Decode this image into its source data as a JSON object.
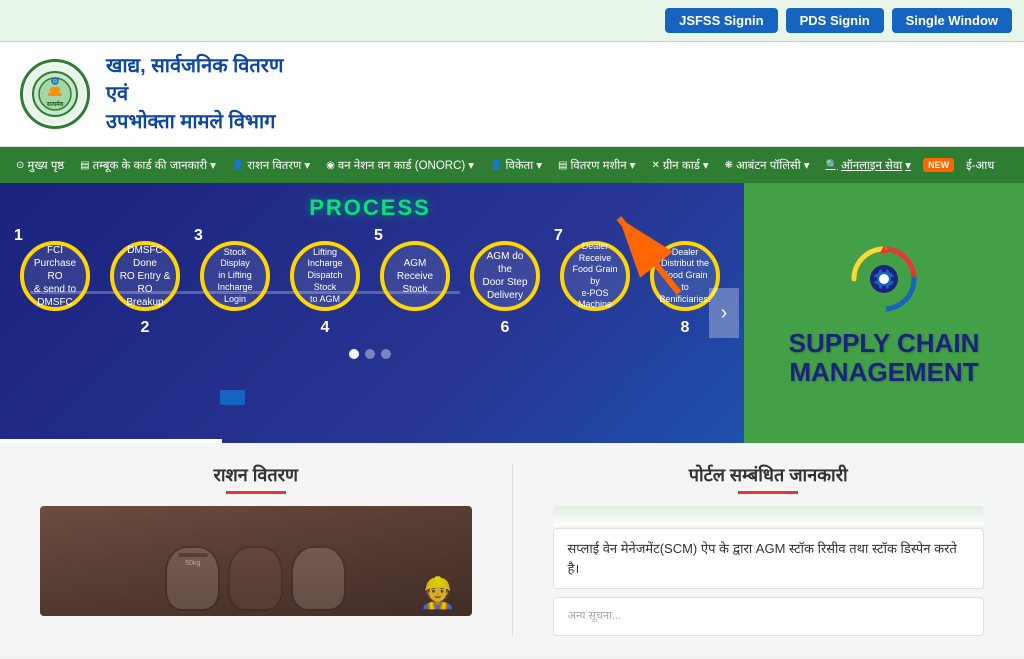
{
  "topbar": {
    "buttons": [
      {
        "id": "jsfss",
        "label": "JSFSS Signin"
      },
      {
        "id": "pds",
        "label": "PDS Signin"
      },
      {
        "id": "single",
        "label": "Single Window"
      }
    ]
  },
  "header": {
    "dept_line1": "खाद्य, सार्वजनिक वितरण",
    "dept_line2": "एवं",
    "dept_line3": "उपभोक्ता मामले विभाग"
  },
  "nav": {
    "items": [
      {
        "id": "home",
        "icon": "⊙",
        "label": "मुख्य पृष्ठ"
      },
      {
        "id": "ration-card",
        "icon": "▤",
        "label": "तम्बूक के कार्ड की जानकारी"
      },
      {
        "id": "ration-dist",
        "icon": "👤",
        "label": "राशन वितरण"
      },
      {
        "id": "onorc",
        "icon": "◉",
        "label": "वन नेशन वन कार्ड (ONORC)"
      },
      {
        "id": "seller",
        "icon": "👤",
        "label": "विकेता"
      },
      {
        "id": "dist-machine",
        "icon": "▤",
        "label": "वितरण मशीन"
      },
      {
        "id": "green-card",
        "icon": "✕",
        "label": "ग्रीन कार्ड"
      },
      {
        "id": "allocation",
        "icon": "❋",
        "label": "आबंटन पॉलिसी"
      },
      {
        "id": "online-service",
        "icon": "🔍",
        "label": "ऑनलाइन सेवा",
        "highlight": true
      },
      {
        "id": "new-badge",
        "label": "NEW"
      },
      {
        "id": "eaadhar",
        "label": "ई-आध"
      }
    ]
  },
  "banner": {
    "process_title": "PROCESS",
    "nodes": [
      {
        "number": "1",
        "text": "FCI Purchase RO & send to DMSFC"
      },
      {
        "number": "2",
        "text": "DMSFC Done RO Entry & RO Breakup"
      },
      {
        "number": "3",
        "text": "Stock Display in Lifting Incharge Login"
      },
      {
        "number": "4",
        "text": "Lifting Incharge Dispatch Stock to AGM"
      },
      {
        "number": "5",
        "text": "AGM Receive Stock"
      },
      {
        "number": "6",
        "text": "AGM do the Door Step Delivery"
      },
      {
        "number": "7",
        "text": "Dealer Receive Food Grain by e-POS Machine"
      },
      {
        "number": "8",
        "text": "Dealer Distribute the Food Grain to Benificiaries."
      }
    ],
    "supply_chain_line1": "SUPPLY CHAIN",
    "supply_chain_line2": "MANAGEMENT",
    "dots": [
      true,
      false,
      false
    ]
  },
  "content": {
    "ration_title": "राशन वितरण",
    "portal_title": "पोर्टल सम्बंधित जानकारी",
    "portal_info1": "सप्लाई वेन मेनेजमेंट(SCM) ऐप के द्वारा AGM स्टॉक रिसीव तथा स्टॉक डिस्पेन करते है।",
    "portal_info2": "अन्य सूचना..."
  }
}
